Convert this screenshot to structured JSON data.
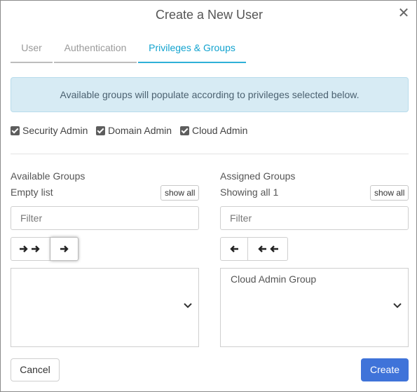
{
  "dialog": {
    "title": "Create a New User",
    "close_glyph": "✕"
  },
  "tabs": [
    {
      "label": "User",
      "active": false
    },
    {
      "label": "Authentication",
      "active": false
    },
    {
      "label": "Privileges & Groups",
      "active": true
    }
  ],
  "alert": {
    "text": "Available groups will populate according to privileges selected below."
  },
  "privileges": [
    {
      "label": "Security Admin",
      "checked": true
    },
    {
      "label": "Domain Admin",
      "checked": true
    },
    {
      "label": "Cloud Admin",
      "checked": true
    }
  ],
  "available": {
    "heading": "Available Groups",
    "status": "Empty list",
    "show_all": "show all",
    "filter_placeholder": "Filter",
    "buttons": [
      "move-all-right",
      "move-selected-right"
    ],
    "items": []
  },
  "assigned": {
    "heading": "Assigned Groups",
    "status": "Showing all 1",
    "show_all": "show all",
    "filter_placeholder": "Filter",
    "buttons": [
      "move-selected-left",
      "move-all-left"
    ],
    "items": [
      "Cloud Admin Group"
    ]
  },
  "footer": {
    "cancel_label": "Cancel",
    "create_label": "Create"
  },
  "colors": {
    "accent": "#12a3cf",
    "primary_button": "#3f73d9",
    "alert_bg": "#d7ebf4"
  }
}
